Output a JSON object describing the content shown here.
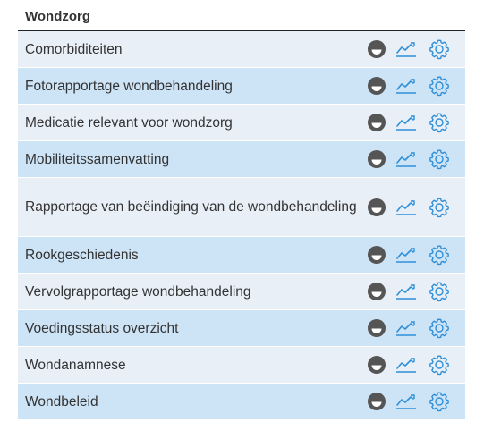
{
  "panel": {
    "title": "Wondzorg"
  },
  "colors": {
    "row_light": "#e8eff7",
    "row_dark": "#cde3f6",
    "icon_blue": "#2f8fd8",
    "status_grey": "#555555"
  },
  "icons": {
    "status": "status-icon",
    "trend": "trend-chart-icon",
    "settings": "gear-icon"
  },
  "rows": [
    {
      "label": "Comorbiditeiten"
    },
    {
      "label": "Fotorapportage wondbehandeling"
    },
    {
      "label": "Medicatie relevant voor wondzorg"
    },
    {
      "label": "Mobiliteitssamenvatting"
    },
    {
      "label": "Rapportage van beëindiging van de wondbehandeling"
    },
    {
      "label": "Rookgeschiedenis"
    },
    {
      "label": "Vervolgrapportage wondbehandeling"
    },
    {
      "label": "Voedingsstatus overzicht"
    },
    {
      "label": "Wondanamnese"
    },
    {
      "label": "Wondbeleid"
    }
  ]
}
